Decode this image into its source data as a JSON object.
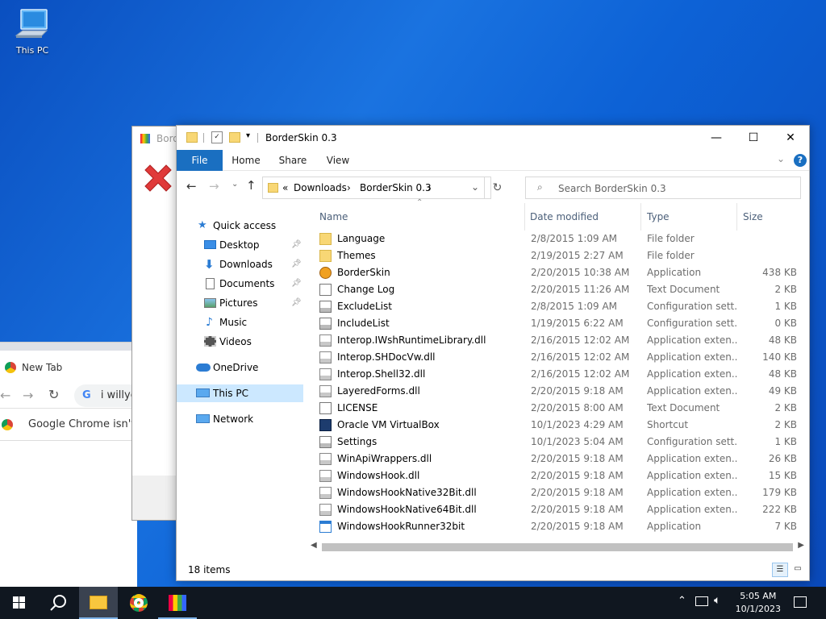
{
  "desktop": {
    "icons": [
      {
        "label": "This PC",
        "icon": "this-pc-icon"
      }
    ]
  },
  "chrome_bg": {
    "tab_label": "New Tab",
    "omnibox_text": "i willyc",
    "infobar_text": "Google Chrome isn't y"
  },
  "dialog_bg": {
    "title": "Bord"
  },
  "explorer": {
    "title": "BorderSkin 0.3",
    "window_controls": {
      "minimize": "—",
      "maximize": "☐",
      "close": "✕"
    },
    "ribbon": {
      "file": "File",
      "home": "Home",
      "share": "Share",
      "view": "View",
      "help": "?"
    },
    "address": {
      "prefix": "«",
      "crumbs": [
        "Downloads",
        "BorderSkin 0.3"
      ]
    },
    "search": {
      "placeholder": "Search BorderSkin 0.3"
    },
    "nav": {
      "quick_access": "Quick access",
      "desktop": "Desktop",
      "downloads": "Downloads",
      "documents": "Documents",
      "pictures": "Pictures",
      "music": "Music",
      "videos": "Videos",
      "onedrive": "OneDrive",
      "this_pc": "This PC",
      "network": "Network"
    },
    "columns": {
      "name": "Name",
      "date": "Date modified",
      "type": "Type",
      "size": "Size"
    },
    "files": [
      {
        "name": "Language",
        "date": "2/8/2015 1:09 AM",
        "type": "File folder",
        "size": "",
        "icon": "folder"
      },
      {
        "name": "Themes",
        "date": "2/19/2015 2:27 AM",
        "type": "File folder",
        "size": "",
        "icon": "folder"
      },
      {
        "name": "BorderSkin",
        "date": "2/20/2015 10:38 AM",
        "type": "Application",
        "size": "438 KB",
        "icon": "app-orange"
      },
      {
        "name": "Change Log",
        "date": "2/20/2015 11:26 AM",
        "type": "Text Document",
        "size": "2 KB",
        "icon": "text"
      },
      {
        "name": "ExcludeList",
        "date": "2/8/2015 1:09 AM",
        "type": "Configuration sett...",
        "size": "1 KB",
        "icon": "config"
      },
      {
        "name": "IncludeList",
        "date": "1/19/2015 6:22 AM",
        "type": "Configuration sett...",
        "size": "0 KB",
        "icon": "config"
      },
      {
        "name": "Interop.IWshRuntimeLibrary.dll",
        "date": "2/16/2015 12:02 AM",
        "type": "Application exten...",
        "size": "48 KB",
        "icon": "dll"
      },
      {
        "name": "Interop.SHDocVw.dll",
        "date": "2/16/2015 12:02 AM",
        "type": "Application exten...",
        "size": "140 KB",
        "icon": "dll"
      },
      {
        "name": "Interop.Shell32.dll",
        "date": "2/16/2015 12:02 AM",
        "type": "Application exten...",
        "size": "48 KB",
        "icon": "dll"
      },
      {
        "name": "LayeredForms.dll",
        "date": "2/20/2015 9:18 AM",
        "type": "Application exten...",
        "size": "49 KB",
        "icon": "dll"
      },
      {
        "name": "LICENSE",
        "date": "2/20/2015 8:00 AM",
        "type": "Text Document",
        "size": "2 KB",
        "icon": "text"
      },
      {
        "name": "Oracle VM VirtualBox",
        "date": "10/1/2023 4:29 AM",
        "type": "Shortcut",
        "size": "2 KB",
        "icon": "vbox"
      },
      {
        "name": "Settings",
        "date": "10/1/2023 5:04 AM",
        "type": "Configuration sett...",
        "size": "1 KB",
        "icon": "config"
      },
      {
        "name": "WinApiWrappers.dll",
        "date": "2/20/2015 9:18 AM",
        "type": "Application exten...",
        "size": "26 KB",
        "icon": "dll"
      },
      {
        "name": "WindowsHook.dll",
        "date": "2/20/2015 9:18 AM",
        "type": "Application exten...",
        "size": "15 KB",
        "icon": "dll"
      },
      {
        "name": "WindowsHookNative32Bit.dll",
        "date": "2/20/2015 9:18 AM",
        "type": "Application exten...",
        "size": "179 KB",
        "icon": "dll"
      },
      {
        "name": "WindowsHookNative64Bit.dll",
        "date": "2/20/2015 9:18 AM",
        "type": "Application exten...",
        "size": "222 KB",
        "icon": "dll"
      },
      {
        "name": "WindowsHookRunner32bit",
        "date": "2/20/2015 9:18 AM",
        "type": "Application",
        "size": "7 KB",
        "icon": "app-window"
      }
    ],
    "status": "18 items"
  },
  "taskbar": {
    "time": "5:05 AM",
    "date": "10/1/2023"
  },
  "colors": {
    "accent": "#1a6fc1",
    "taskbar": "#101720",
    "selection": "#cce8ff",
    "folder": "#f8d775"
  }
}
